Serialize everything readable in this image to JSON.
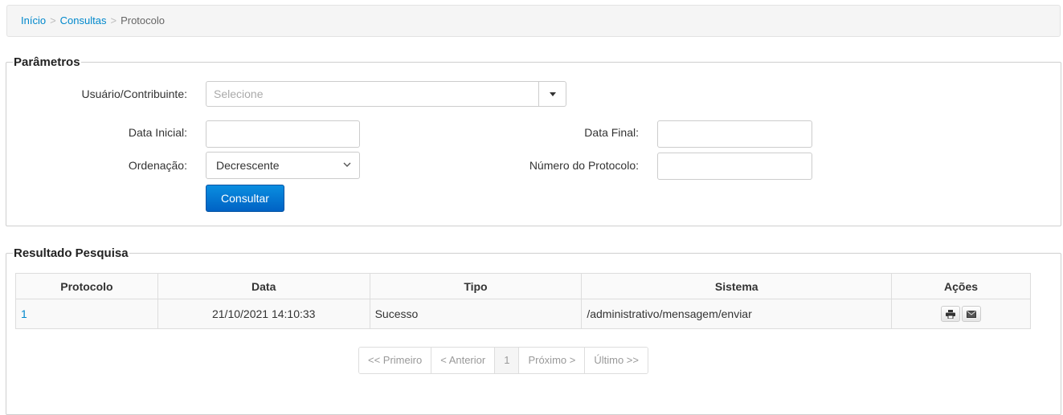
{
  "breadcrumb": {
    "home": "Início",
    "consultas": "Consultas",
    "current": "Protocolo",
    "separator": ">"
  },
  "params": {
    "legend": "Parâmetros",
    "usuario_label": "Usuário/Contribuinte:",
    "usuario_placeholder": "Selecione",
    "data_inicial_label": "Data Inicial:",
    "data_inicial_value": "",
    "data_final_label": "Data Final:",
    "data_final_value": "",
    "ordenacao_label": "Ordenação:",
    "ordenacao_value": "Decrescente",
    "numero_label": "Número do Protocolo:",
    "numero_value": "",
    "submit_label": "Consultar"
  },
  "results": {
    "legend": "Resultado Pesquisa",
    "columns": [
      "Protocolo",
      "Data",
      "Tipo",
      "Sistema",
      "Ações"
    ],
    "rows": [
      {
        "protocolo": "1",
        "data": "21/10/2021 14:10:33",
        "tipo": "Sucesso",
        "sistema": "/administrativo/mensagem/enviar",
        "actions": [
          "print-icon",
          "envelope-icon"
        ]
      }
    ]
  },
  "pagination": {
    "first": "<< Primeiro",
    "prev": "< Anterior",
    "current": "1",
    "next": "Próximo >",
    "last": "Último >>"
  },
  "colors": {
    "link": "#0088cc",
    "primary_button": "#0a72d4",
    "border": "#cccccc"
  }
}
